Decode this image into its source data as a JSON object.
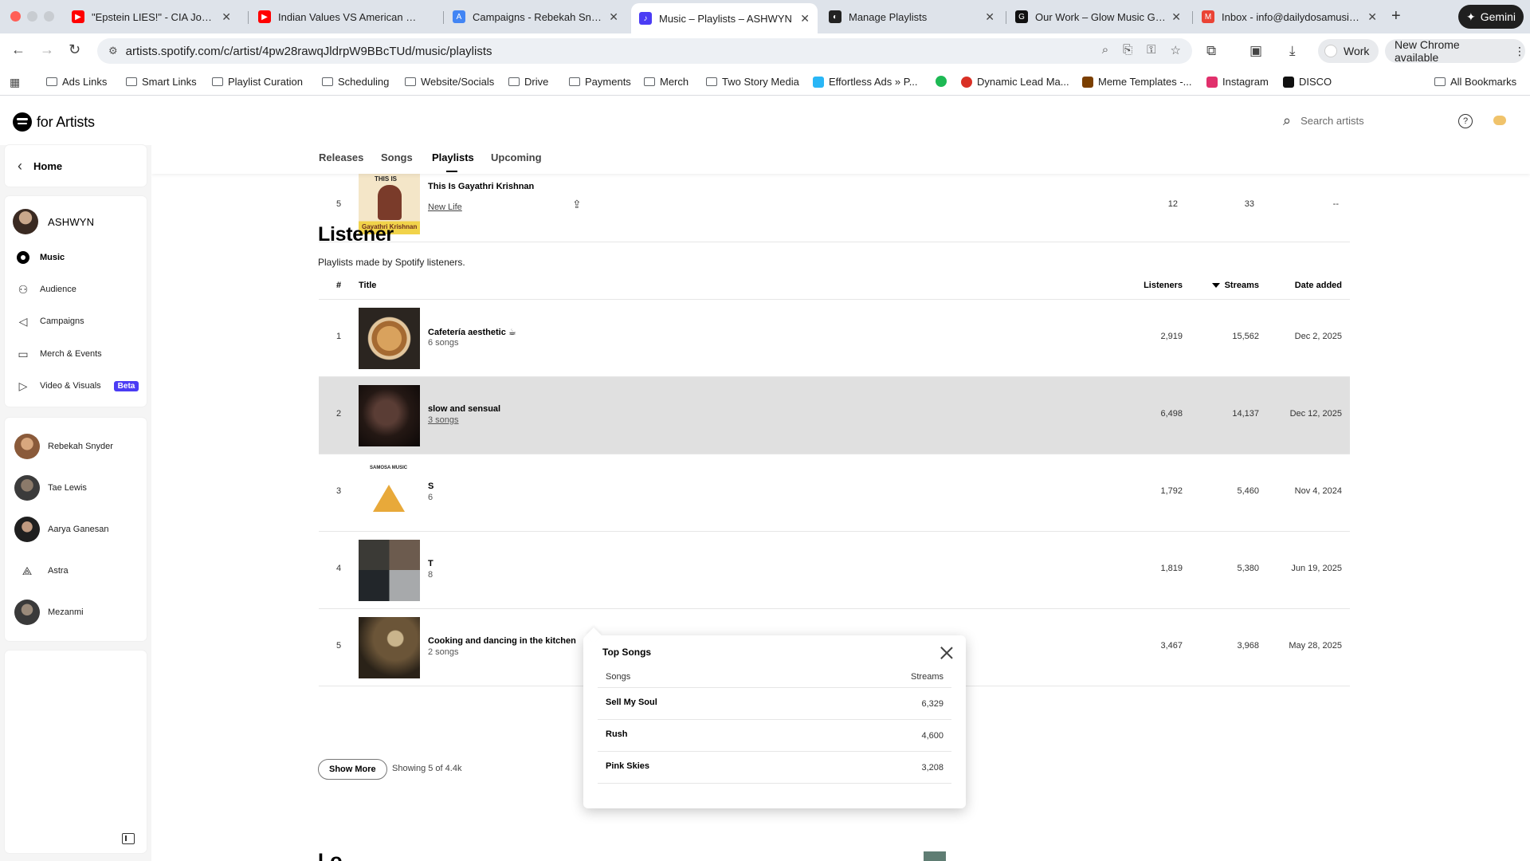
{
  "browser": {
    "tabs": [
      {
        "title": "\"Epstein LIES!\" - CIA John Kiriakou",
        "favicon_color": "#ff0000"
      },
      {
        "title": "Indian Values VS American Values",
        "favicon_color": "#ff0000"
      },
      {
        "title": "Campaigns - Rebekah Snyder",
        "favicon_color": "#4285f4"
      },
      {
        "title": "Music – Playlists – ASHWYN",
        "favicon_color": "#4b3cf4"
      },
      {
        "title": "Manage Playlists",
        "favicon_color": "#222222"
      },
      {
        "title": "Our Work – Glow Music Group",
        "favicon_color": "#111111"
      },
      {
        "title": "Inbox - info@dailydosamusic.com",
        "favicon_color": "#ea4335"
      }
    ],
    "gemini_label": "Gemini",
    "url": "artists.spotify.com/c/artist/4pw28rawqJldrpW9BBcTUd/music/playlists",
    "work_label": "Work",
    "update_label": "New Chrome available",
    "bookmarks": [
      {
        "label": "Ads Links",
        "type": "folder"
      },
      {
        "label": "Smart Links",
        "type": "folder"
      },
      {
        "label": "Playlist Curation",
        "type": "folder"
      },
      {
        "label": "Scheduling",
        "type": "folder"
      },
      {
        "label": "Website/Socials",
        "type": "folder"
      },
      {
        "label": "Drive",
        "type": "folder"
      },
      {
        "label": "Payments",
        "type": "folder"
      },
      {
        "label": "Merch",
        "type": "folder"
      },
      {
        "label": "Two Story Media",
        "type": "folder"
      },
      {
        "label": "Effortless Ads » P...",
        "type": "site",
        "color": "#29b6f6"
      },
      {
        "label": "",
        "type": "site",
        "color": "#1db954"
      },
      {
        "label": "Dynamic Lead Ma...",
        "type": "site",
        "color": "#d93025"
      },
      {
        "label": "Meme Templates -...",
        "type": "site",
        "color": "#7b3f00"
      },
      {
        "label": "Instagram",
        "type": "site",
        "color": "#e1306c"
      },
      {
        "label": "DISCO",
        "type": "site",
        "color": "#111111"
      }
    ],
    "all_bookmarks": "All Bookmarks"
  },
  "app": {
    "brand": "for Artists",
    "search_placeholder": "Search artists",
    "help": "?"
  },
  "sidebar": {
    "home": "Home",
    "artist_name": "ASHWYN",
    "nav": [
      {
        "label": "Music",
        "active": true,
        "icon": "music-icon"
      },
      {
        "label": "Audience",
        "active": false,
        "icon": "audience-icon"
      },
      {
        "label": "Campaigns",
        "active": false,
        "icon": "campaigns-icon"
      },
      {
        "label": "Merch & Events",
        "active": false,
        "icon": "merch-icon"
      },
      {
        "label": "Video & Visuals",
        "active": false,
        "icon": "video-icon"
      }
    ],
    "beta_badge": "Beta",
    "other_artists": [
      {
        "name": "Rebekah Snyder",
        "color": "#b07a55"
      },
      {
        "name": "Tae Lewis",
        "color": "#3b3b3b"
      },
      {
        "name": "Aarya Ganesan",
        "color": "#2a2a2a"
      },
      {
        "name": "Astra",
        "color": "#555555"
      },
      {
        "name": "Mezanmi",
        "color": "#444444"
      }
    ]
  },
  "subtabs": [
    {
      "label": "Releases",
      "active": false
    },
    {
      "label": "Songs",
      "active": false
    },
    {
      "label": "Playlists",
      "active": true
    },
    {
      "label": "Upcoming",
      "active": false
    }
  ],
  "previous_row": {
    "num": "5",
    "title": "This Is Gayathri Krishnan",
    "subtitle": "New Life",
    "cover_top_text": "THIS IS",
    "cover_bottom_text": "Gayathri Krishnan",
    "col1": "12",
    "col2": "33",
    "col3": "--"
  },
  "listener": {
    "title": "Listener",
    "description": "Playlists made by Spotify listeners.",
    "columns": {
      "num": "#",
      "title": "Title",
      "listeners": "Listeners",
      "streams": "Streams",
      "date": "Date added"
    },
    "rows": [
      {
        "num": "1",
        "title": "Cafetería aesthetic ☕",
        "subtitle": "6 songs",
        "listeners": "2,919",
        "streams": "15,562",
        "date": "Dec 2, 2025"
      },
      {
        "num": "2",
        "title": "slow and sensual",
        "subtitle": "3 songs",
        "listeners": "6,498",
        "streams": "14,137",
        "date": "Dec 12, 2025"
      },
      {
        "num": "3",
        "title": "S",
        "subtitle": "6",
        "listeners": "1,792",
        "streams": "5,460",
        "date": "Nov 4, 2024"
      },
      {
        "num": "4",
        "title": "T",
        "subtitle": "8",
        "listeners": "1,819",
        "streams": "5,380",
        "date": "Jun 19, 2025"
      },
      {
        "num": "5",
        "title": "Cooking and dancing in the kitchen",
        "subtitle": "2 songs",
        "listeners": "3,467",
        "streams": "3,968",
        "date": "May 28, 2025"
      }
    ],
    "cover3_label": "SAMOSA MUSIC",
    "show_more": "Show More",
    "showing": "Showing 5 of 4.4k"
  },
  "next_section_title": "Lo...",
  "popup": {
    "title": "Top Songs",
    "col_songs": "Songs",
    "col_streams": "Streams",
    "rows": [
      {
        "song": "Sell My Soul",
        "streams": "6,329"
      },
      {
        "song": "Rush",
        "streams": "4,600"
      },
      {
        "song": "Pink Skies",
        "streams": "3,208"
      }
    ]
  }
}
